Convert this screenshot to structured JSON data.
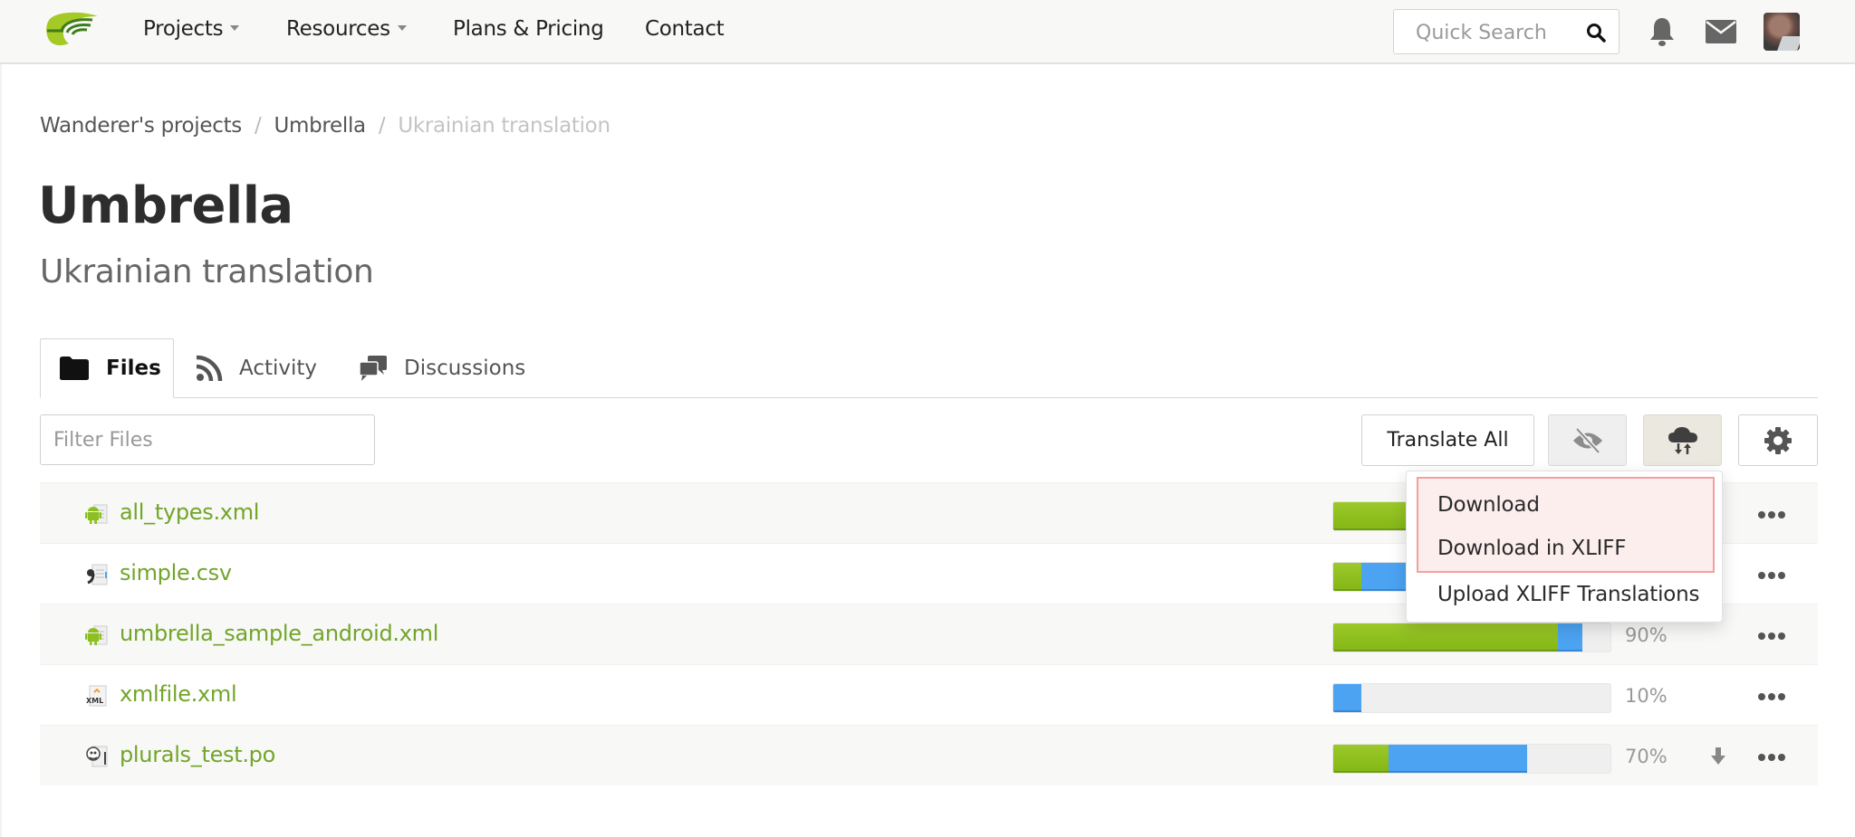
{
  "nav": {
    "items": [
      {
        "label": "Projects",
        "has_caret": true
      },
      {
        "label": "Resources",
        "has_caret": true
      },
      {
        "label": "Plans & Pricing",
        "has_caret": false
      },
      {
        "label": "Contact",
        "has_caret": false
      }
    ],
    "search_placeholder": "Quick Search",
    "icons": [
      "search-icon",
      "bell-icon",
      "mail-icon",
      "avatar"
    ]
  },
  "breadcrumb": {
    "items": [
      "Wanderer's projects",
      "Umbrella"
    ],
    "current": "Ukrainian translation",
    "separator": "/"
  },
  "page": {
    "title": "Umbrella",
    "subtitle": "Ukrainian translation"
  },
  "tabs": [
    {
      "label": "Files",
      "icon": "folder-icon",
      "active": true
    },
    {
      "label": "Activity",
      "icon": "rss-icon",
      "active": false
    },
    {
      "label": "Discussions",
      "icon": "chat-icon",
      "active": false
    }
  ],
  "toolbar": {
    "filter_placeholder": "Filter Files",
    "translate_all_label": "Translate All",
    "icons": [
      "eye-slash-icon",
      "cloud-upload-download-icon",
      "gear-icon"
    ]
  },
  "dropdown": {
    "items": [
      "Download",
      "Download in XLIFF",
      "Upload XLIFF Translations"
    ],
    "highlighted": [
      "Download",
      "Download in XLIFF"
    ]
  },
  "files": [
    {
      "name": "all_types.xml",
      "type": "android",
      "approved_pct": 100,
      "translated_pct": 100,
      "progress_label": "",
      "download": false
    },
    {
      "name": "simple.csv",
      "type": "csv",
      "approved_pct": 10,
      "translated_pct": 30,
      "progress_label": "",
      "download": false
    },
    {
      "name": "umbrella_sample_android.xml",
      "type": "android",
      "approved_pct": 81,
      "translated_pct": 90,
      "progress_label": "90%",
      "download": false
    },
    {
      "name": "xmlfile.xml",
      "type": "xml",
      "approved_pct": 0,
      "translated_pct": 10,
      "progress_label": "10%",
      "download": false
    },
    {
      "name": "plurals_test.po",
      "type": "gettext",
      "approved_pct": 20,
      "translated_pct": 70,
      "progress_label": "70%",
      "download": true
    }
  ],
  "colors": {
    "accent_green": "#72a52a",
    "approved_green": "#8cbf1f",
    "translated_blue": "#4ba3f2",
    "highlight_border": "#f4a0a0",
    "highlight_bg": "#fdeeee"
  }
}
